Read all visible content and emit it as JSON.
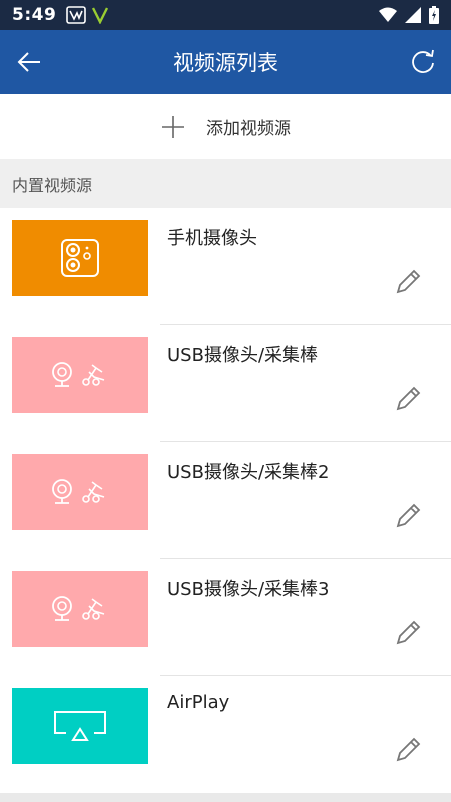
{
  "status": {
    "time": "5:49"
  },
  "header": {
    "title": "视频源列表",
    "back_icon": "arrow-left-icon",
    "refresh_icon": "refresh-icon"
  },
  "add": {
    "label": "添加视频源",
    "icon": "plus-icon"
  },
  "section": {
    "label": "内置视频源"
  },
  "items": [
    {
      "title": "手机摄像头",
      "thumb_color": "#f08c00",
      "icon": "phone-camera-icon"
    },
    {
      "title": "USB摄像头/采集棒",
      "thumb_color": "#ffa9ac",
      "icon": "usb-camera-icon"
    },
    {
      "title": "USB摄像头/采集棒2",
      "thumb_color": "#ffa9ac",
      "icon": "usb-camera-icon"
    },
    {
      "title": "USB摄像头/采集棒3",
      "thumb_color": "#ffa9ac",
      "icon": "usb-camera-icon"
    },
    {
      "title": "AirPlay",
      "thumb_color": "#00cfc3",
      "icon": "airplay-icon"
    }
  ],
  "colors": {
    "status_bar": "#1b2a44",
    "app_bar": "#1f57a3",
    "section_bg": "#efefef"
  }
}
